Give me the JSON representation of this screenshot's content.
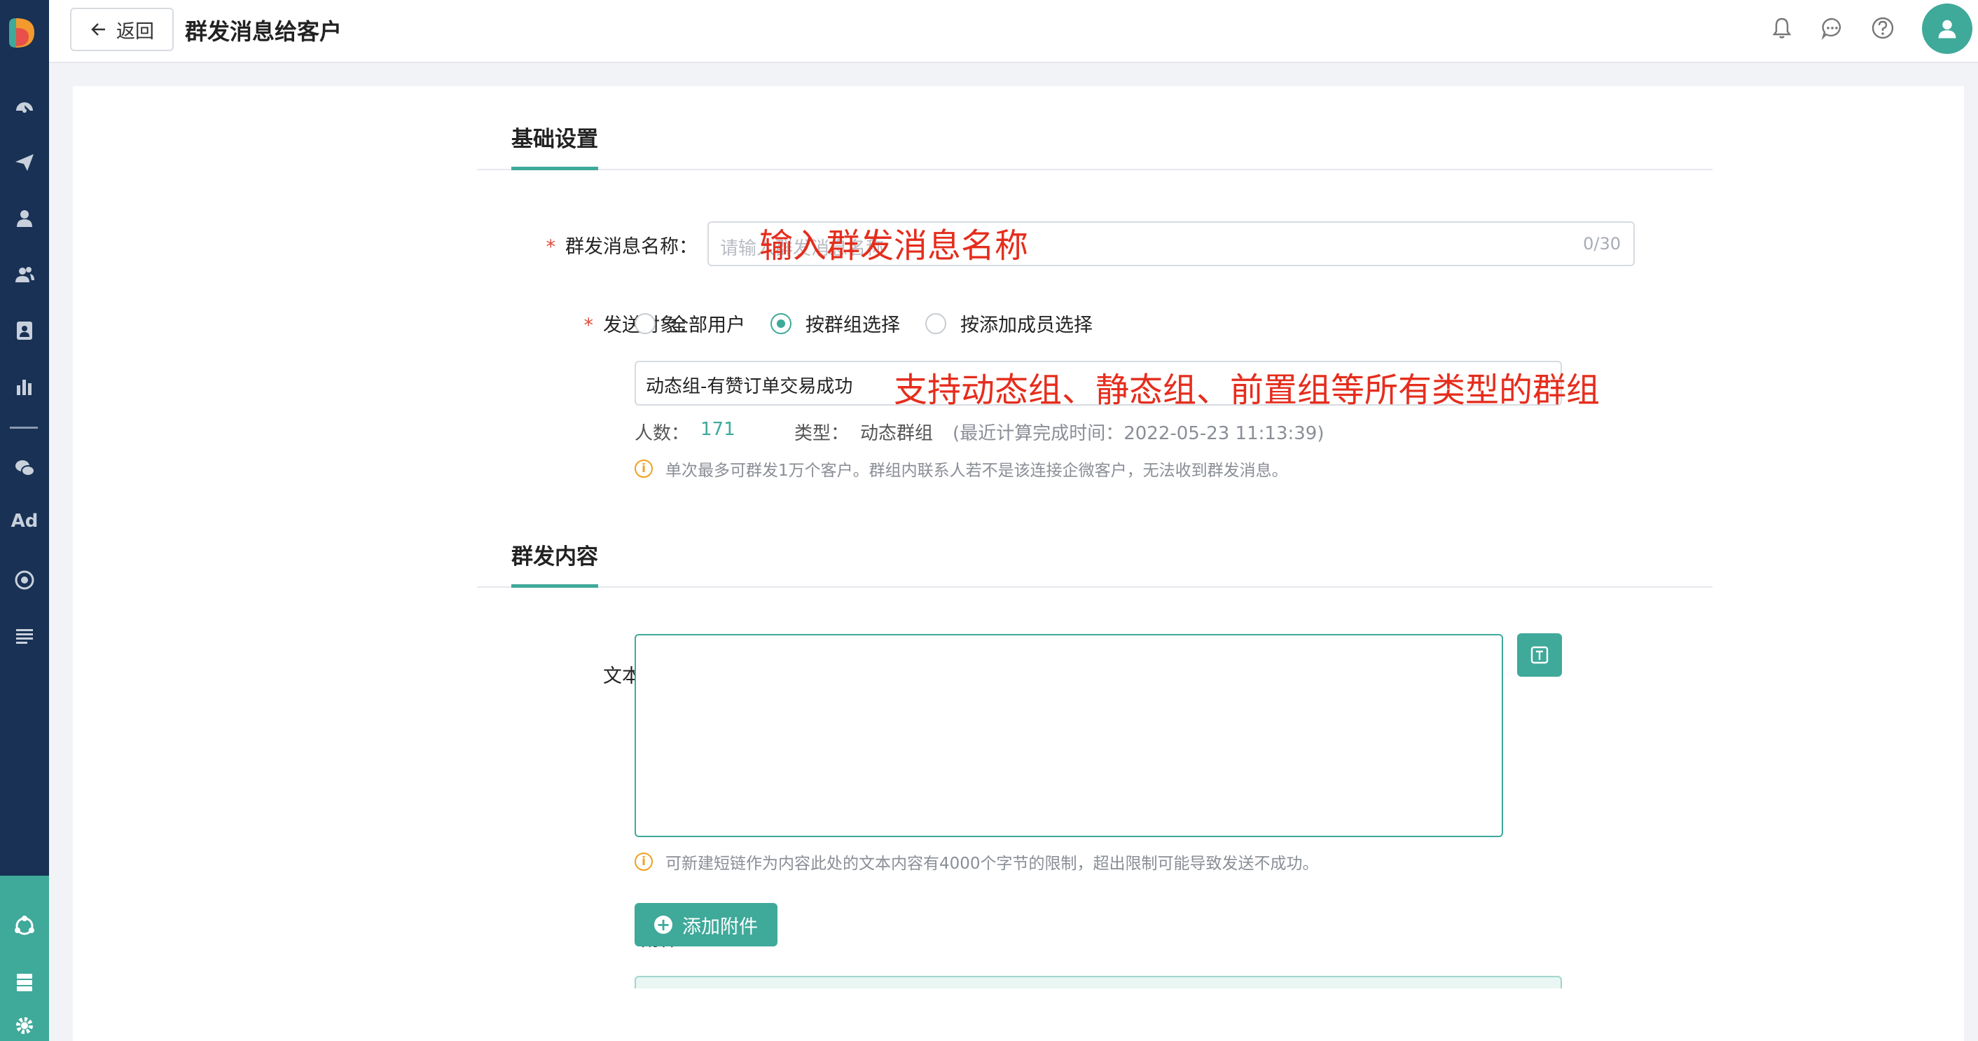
{
  "topbar": {
    "back_label": "返回",
    "page_title": "群发消息给客户"
  },
  "sidebar": {
    "ad_label": "Ad",
    "icons": [
      "dashboard-icon",
      "send-icon",
      "user-icon",
      "users-icon",
      "contact-card-icon",
      "bar-chart-icon",
      "wechat-icon",
      "target-icon",
      "list-icon",
      "network-icon",
      "server-icon",
      "gear-icon"
    ]
  },
  "basic_section": {
    "title": "基础设置",
    "name_label": "群发消息名称：",
    "name_required": "*",
    "name_placeholder": "请输入群发消息名称",
    "name_counter": "0/30",
    "name_annotation": "输入群发消息名称",
    "target_label": "发送对象：",
    "target_required": "*",
    "target_options": [
      "全部用户",
      "按群组选择",
      "按添加成员选择"
    ],
    "target_selected_index": 1,
    "group_value": "动态组-有赞订单交易成功",
    "group_annotation": "支持动态组、静态组、前置组等所有类型的群组",
    "count_label": "人数：",
    "count_value": "171",
    "type_label": "类型：",
    "type_value": "动态群组",
    "calc_time": "(最近计算完成时间：2022-05-23 11:13:39)",
    "note": "单次最多可群发1万个客户。群组内联系人若不是该连接企微客户，无法收到群发消息。"
  },
  "content_section": {
    "title": "群发内容",
    "text_label": "文本内容：",
    "text_value": "",
    "note": "可新建短链作为内容此处的文本内容有4000个字节的限制，超出限制可能导致发送不成功。",
    "attach_label": "附件：",
    "add_attach_label": "添加附件"
  },
  "colors": {
    "accent": "#3fa99a",
    "sidebar": "#183154",
    "annotation": "#e52d1d",
    "required": "#e24a3b"
  }
}
